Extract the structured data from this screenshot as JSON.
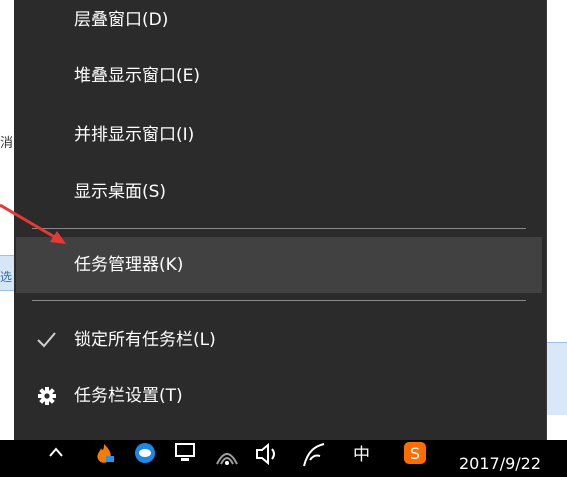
{
  "desktop": {
    "left_fragment_1": "消",
    "left_fragment_2": "选"
  },
  "menu": {
    "items": [
      {
        "label": "层叠窗口(D)"
      },
      {
        "label": "堆叠显示窗口(E)"
      },
      {
        "label": "并排显示窗口(I)"
      },
      {
        "label": "显示桌面(S)"
      },
      {
        "label": "任务管理器(K)"
      },
      {
        "label": "锁定所有任务栏(L)"
      },
      {
        "label": "任务栏设置(T)"
      }
    ],
    "hover_item": "任务管理器(K)",
    "checked_item": "锁定所有任务栏(L)"
  },
  "taskbar": {
    "ime_label": "中",
    "clock_date": "2017/9/22"
  },
  "colors": {
    "menu_bg": "#2b2b2b",
    "hover_bg": "#414141",
    "separator": "#8a8a8a",
    "annotation_arrow": "#e53935"
  },
  "icons": [
    "check-icon",
    "gear-icon",
    "chevron-up-icon",
    "fire-icon",
    "cloud-icon",
    "network-icon",
    "wifi-icon",
    "speaker-icon",
    "pen-icon",
    "sogou-icon"
  ]
}
